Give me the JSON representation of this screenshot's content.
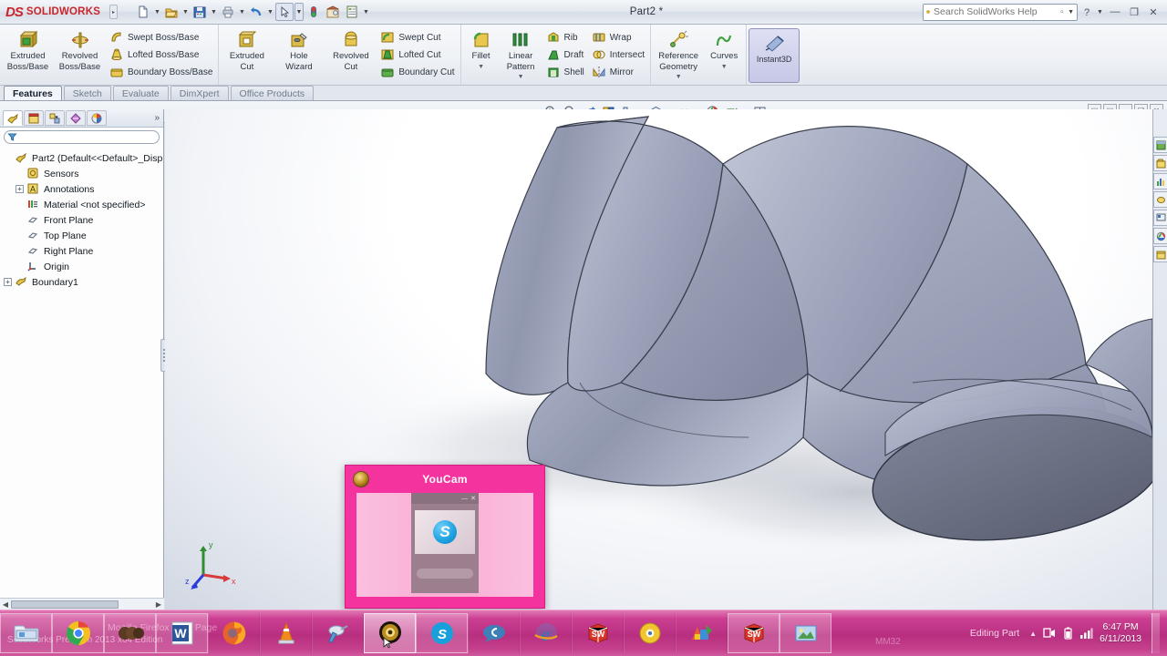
{
  "titlebar": {
    "brand_ds": "DS",
    "brand_name": "SOLIDWORKS",
    "document_title": "Part2 *",
    "quick_access": [
      {
        "name": "new-document",
        "icon": "new-doc-icon"
      },
      {
        "name": "open-document",
        "icon": "open-folder-icon"
      },
      {
        "name": "save-document",
        "icon": "save-disk-icon"
      },
      {
        "name": "print-document",
        "icon": "printer-icon"
      },
      {
        "name": "undo",
        "icon": "undo-arrow-icon"
      },
      {
        "name": "select",
        "icon": "cursor-arrow-icon"
      },
      {
        "name": "rebuild",
        "icon": "traffic-light-icon"
      },
      {
        "name": "options",
        "icon": "gear-house-icon"
      },
      {
        "name": "customize",
        "icon": "list-icon"
      }
    ],
    "search": {
      "placeholder": "Search SolidWorks Help",
      "icon": "magnifier-icon"
    },
    "help_icon": "question-mark-icon",
    "window_buttons": [
      "minimize",
      "restore",
      "close"
    ]
  },
  "ribbon": {
    "groups": [
      {
        "name": "boss-base",
        "big": [
          {
            "label_line1": "Extruded",
            "label_line2": "Boss/Base",
            "icon": "extrude-boss-icon"
          },
          {
            "label_line1": "Revolved",
            "label_line2": "Boss/Base",
            "icon": "revolve-boss-icon"
          }
        ],
        "small": [
          {
            "label": "Swept Boss/Base",
            "icon": "swept-boss-icon"
          },
          {
            "label": "Lofted Boss/Base",
            "icon": "lofted-boss-icon"
          },
          {
            "label": "Boundary Boss/Base",
            "icon": "boundary-boss-icon"
          }
        ]
      },
      {
        "name": "cut",
        "big": [
          {
            "label_line1": "Extruded",
            "label_line2": "Cut",
            "icon": "extrude-cut-icon"
          },
          {
            "label_line1": "Hole",
            "label_line2": "Wizard",
            "icon": "hole-wizard-icon"
          },
          {
            "label_line1": "Revolved",
            "label_line2": "Cut",
            "icon": "revolve-cut-icon"
          }
        ],
        "small": [
          {
            "label": "Swept Cut",
            "icon": "swept-cut-icon"
          },
          {
            "label": "Lofted Cut",
            "icon": "lofted-cut-icon"
          },
          {
            "label": "Boundary Cut",
            "icon": "boundary-cut-icon"
          }
        ]
      },
      {
        "name": "features",
        "big": [
          {
            "label_line1": "Fillet",
            "label_line2": "",
            "icon": "fillet-icon"
          },
          {
            "label_line1": "Linear",
            "label_line2": "Pattern",
            "icon": "linear-pattern-icon"
          }
        ],
        "small": [
          {
            "label": "Rib",
            "icon": "rib-icon"
          },
          {
            "label": "Draft",
            "icon": "draft-icon"
          },
          {
            "label": "Shell",
            "icon": "shell-icon"
          }
        ],
        "small2": [
          {
            "label": "Wrap",
            "icon": "wrap-icon"
          },
          {
            "label": "Intersect",
            "icon": "intersect-icon"
          },
          {
            "label": "Mirror",
            "icon": "mirror-icon"
          }
        ]
      },
      {
        "name": "reference",
        "big": [
          {
            "label_line1": "Reference",
            "label_line2": "Geometry",
            "icon": "reference-geometry-icon"
          },
          {
            "label_line1": "Curves",
            "label_line2": "",
            "icon": "curves-icon"
          }
        ]
      },
      {
        "name": "instant3d",
        "toggle": {
          "label": "Instant3D",
          "icon": "instant3d-icon",
          "active": true
        }
      }
    ]
  },
  "command_tabs": [
    {
      "label": "Features",
      "active": true
    },
    {
      "label": "Sketch",
      "active": false
    },
    {
      "label": "Evaluate",
      "active": false
    },
    {
      "label": "DimXpert",
      "active": false
    },
    {
      "label": "Office Products",
      "active": false
    }
  ],
  "view_toolbar": [
    {
      "name": "zoom-to-fit",
      "icon": "zoom-fit-icon"
    },
    {
      "name": "zoom-to-area",
      "icon": "zoom-area-icon"
    },
    {
      "name": "previous-view",
      "icon": "previous-view-icon"
    },
    {
      "name": "section-view",
      "icon": "section-view-icon"
    },
    {
      "name": "view-orientation",
      "icon": "view-orientation-icon",
      "has_caret": true
    },
    {
      "name": "display-style",
      "icon": "display-style-cube-icon",
      "has_caret": true
    },
    {
      "name": "hide-show-items",
      "icon": "glasses-icon",
      "has_caret": true
    },
    {
      "name": "apply-scene",
      "icon": "scene-sphere-icon"
    },
    {
      "name": "view-settings",
      "icon": "paint-cart-icon",
      "has_caret": true
    },
    {
      "name": "viewport",
      "icon": "viewport-icon",
      "has_caret": true
    }
  ],
  "document_controls": [
    {
      "name": "restore-left",
      "icon": "restore-left-icon"
    },
    {
      "name": "restore-right",
      "icon": "restore-right-icon"
    },
    {
      "name": "minimize-doc",
      "icon": "minimize-icon"
    },
    {
      "name": "maximize-doc",
      "icon": "maximize-icon"
    },
    {
      "name": "close-doc",
      "icon": "close-x-icon"
    }
  ],
  "feature_tree": {
    "tabs": [
      {
        "name": "feature-manager-tab",
        "icon": "feature-tree-icon",
        "active": true
      },
      {
        "name": "property-manager-tab",
        "icon": "property-manager-icon",
        "active": false
      },
      {
        "name": "configuration-manager-tab",
        "icon": "configuration-icon",
        "active": false
      },
      {
        "name": "dimxpert-manager-tab",
        "icon": "dimxpert-icon",
        "active": false
      },
      {
        "name": "display-manager-tab",
        "icon": "display-manager-icon",
        "active": false
      }
    ],
    "more_label": "»",
    "filter_icon": "filter-funnel-icon",
    "items": [
      {
        "label": "Part2  (Default<<Default>_Disp",
        "icon": "part-icon",
        "expandable": false,
        "indent": 0
      },
      {
        "label": "Sensors",
        "icon": "sensors-icon",
        "expandable": false,
        "indent": 1
      },
      {
        "label": "Annotations",
        "icon": "annotations-icon",
        "expandable": true,
        "indent": 1
      },
      {
        "label": "Material <not specified>",
        "icon": "material-icon",
        "expandable": false,
        "indent": 1
      },
      {
        "label": "Front Plane",
        "icon": "plane-icon",
        "expandable": false,
        "indent": 1
      },
      {
        "label": "Top Plane",
        "icon": "plane-icon",
        "expandable": false,
        "indent": 1
      },
      {
        "label": "Right Plane",
        "icon": "plane-icon",
        "expandable": false,
        "indent": 1
      },
      {
        "label": "Origin",
        "icon": "origin-icon",
        "expandable": false,
        "indent": 1
      },
      {
        "label": "Boundary1",
        "icon": "boundary-surface-icon",
        "expandable": true,
        "indent": 0
      }
    ]
  },
  "graphics": {
    "model_name": "boundary-surface-model",
    "triad": {
      "x_label": "x",
      "y_label": "y",
      "z_label": "z",
      "x_color": "#d93b3b",
      "y_color": "#2f8f2f",
      "z_color": "#2f3bd9"
    }
  },
  "task_pane": [
    {
      "name": "solidworks-resources-tab",
      "icon": "sw-resources-icon"
    },
    {
      "name": "design-library-tab",
      "icon": "design-library-icon"
    },
    {
      "name": "file-explorer-tab",
      "icon": "file-explorer-icon"
    },
    {
      "name": "search-tab",
      "icon": "search-tab-icon"
    },
    {
      "name": "view-palette-tab",
      "icon": "view-palette-icon"
    },
    {
      "name": "appearances-tab",
      "icon": "appearances-sphere-icon"
    },
    {
      "name": "custom-properties-tab",
      "icon": "custom-properties-icon"
    }
  ],
  "youcam_popup": {
    "title": "YouCam",
    "logo_icon": "youcam-lens-icon",
    "inner_window": {
      "title": "",
      "minimize_icon": "minimize-icon",
      "close_icon": "close-x-icon",
      "preview_brand": "S"
    },
    "accent_color": "#f5339e"
  },
  "taskbar": {
    "items": [
      {
        "name": "file-explorer",
        "icon": "folder-icon",
        "state": "opened"
      },
      {
        "name": "google-chrome",
        "icon": "chrome-icon",
        "state": "opened"
      },
      {
        "name": "media-app",
        "icon": "brown-circles-icon",
        "state": "opened"
      },
      {
        "name": "microsoft-word",
        "icon": "word-icon",
        "state": "opened"
      },
      {
        "name": "mozilla-firefox",
        "icon": "firefox-icon",
        "state": "normal"
      },
      {
        "name": "vlc-media-player",
        "icon": "vlc-cone-icon",
        "state": "normal"
      },
      {
        "name": "tools-app",
        "icon": "tools-icon",
        "state": "normal"
      },
      {
        "name": "youcam",
        "icon": "youcam-lens-icon",
        "state": "active"
      },
      {
        "name": "skype",
        "icon": "skype-icon",
        "state": "opened"
      },
      {
        "name": "chat-app",
        "icon": "chat-bubble-icon",
        "state": "normal"
      },
      {
        "name": "internet-explorer",
        "icon": "ie-icon",
        "state": "normal"
      },
      {
        "name": "solidworks",
        "icon": "solidworks-cube-icon",
        "state": "normal"
      },
      {
        "name": "disc-burner",
        "icon": "disc-icon",
        "state": "normal"
      },
      {
        "name": "graphics-app",
        "icon": "colored-shapes-icon",
        "state": "normal"
      },
      {
        "name": "solidworks-part2",
        "icon": "solidworks-cube-icon",
        "state": "opened"
      },
      {
        "name": "photo-viewer",
        "icon": "picture-icon",
        "state": "opened"
      }
    ],
    "ghost_text": {
      "sw_edition": "SolidWorks Premium 2013 x64 Edition",
      "mozilla": "Mozilla Firefox Start Page",
      "mm": "MM32"
    },
    "status": "Editing Part",
    "tray": [
      {
        "name": "network-tray-icon",
        "icon": "network-icon"
      },
      {
        "name": "battery-tray-icon",
        "icon": "battery-icon"
      },
      {
        "name": "volume-tray-icon",
        "icon": "volume-bars-icon"
      }
    ],
    "clock": {
      "time": "6:47 PM",
      "date": "6/11/2013"
    }
  }
}
